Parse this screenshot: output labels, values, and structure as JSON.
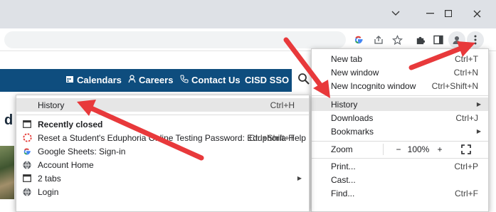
{
  "window_controls": {
    "collapse_icon": "chevron-down",
    "minimize_icon": "minimize",
    "maximize_icon": "maximize",
    "close_icon": "close"
  },
  "toolbar": {
    "icons": [
      "google-icon",
      "share-icon",
      "bookmark-star-icon",
      "extensions-puzzle-icon",
      "side-panel-icon",
      "profile-icon",
      "kebab-menu-icon"
    ]
  },
  "site_nav": {
    "items": [
      {
        "label": "Calendars",
        "icon": "calendar-icon"
      },
      {
        "label": "Careers",
        "icon": "person-icon"
      },
      {
        "label": "Contact Us",
        "icon": "phone-icon"
      },
      {
        "label": "CISD SSO",
        "icon": ""
      }
    ]
  },
  "page": {
    "heading_fragment": "d"
  },
  "main_menu": {
    "new_tab": {
      "label": "New tab",
      "shortcut": "Ctrl+T"
    },
    "new_window": {
      "label": "New window",
      "shortcut": "Ctrl+N"
    },
    "new_incognito": {
      "label": "New Incognito window",
      "shortcut": "Ctrl+Shift+N"
    },
    "history": {
      "label": "History"
    },
    "downloads": {
      "label": "Downloads",
      "shortcut": "Ctrl+J"
    },
    "bookmarks": {
      "label": "Bookmarks"
    },
    "zoom": {
      "label": "Zoom",
      "minus": "−",
      "value": "100%",
      "plus": "+"
    },
    "print": {
      "label": "Print...",
      "shortcut": "Ctrl+P"
    },
    "cast": {
      "label": "Cast..."
    },
    "find": {
      "label": "Find...",
      "shortcut": "Ctrl+F"
    }
  },
  "history_menu": {
    "history": {
      "label": "History",
      "shortcut": "Ctrl+H"
    },
    "recently_closed": {
      "label": "Recently closed"
    },
    "items": [
      {
        "label": "Reset a Student's Eduphoria Online Testing Password: Eduphoria Help",
        "shortcut": "Ctrl+Shift+T",
        "icon": "eduphoria-icon"
      },
      {
        "label": "Google Sheets: Sign-in",
        "icon": "google-icon"
      },
      {
        "label": "Account Home",
        "icon": "globe-icon"
      },
      {
        "label": "2 tabs",
        "icon": "window-icon"
      },
      {
        "label": "Login",
        "icon": "globe-icon"
      }
    ]
  },
  "colors": {
    "nav_bg": "#0e4d7e",
    "arrow": "#e8393b",
    "menu_highlight": "#e6e6e6"
  }
}
